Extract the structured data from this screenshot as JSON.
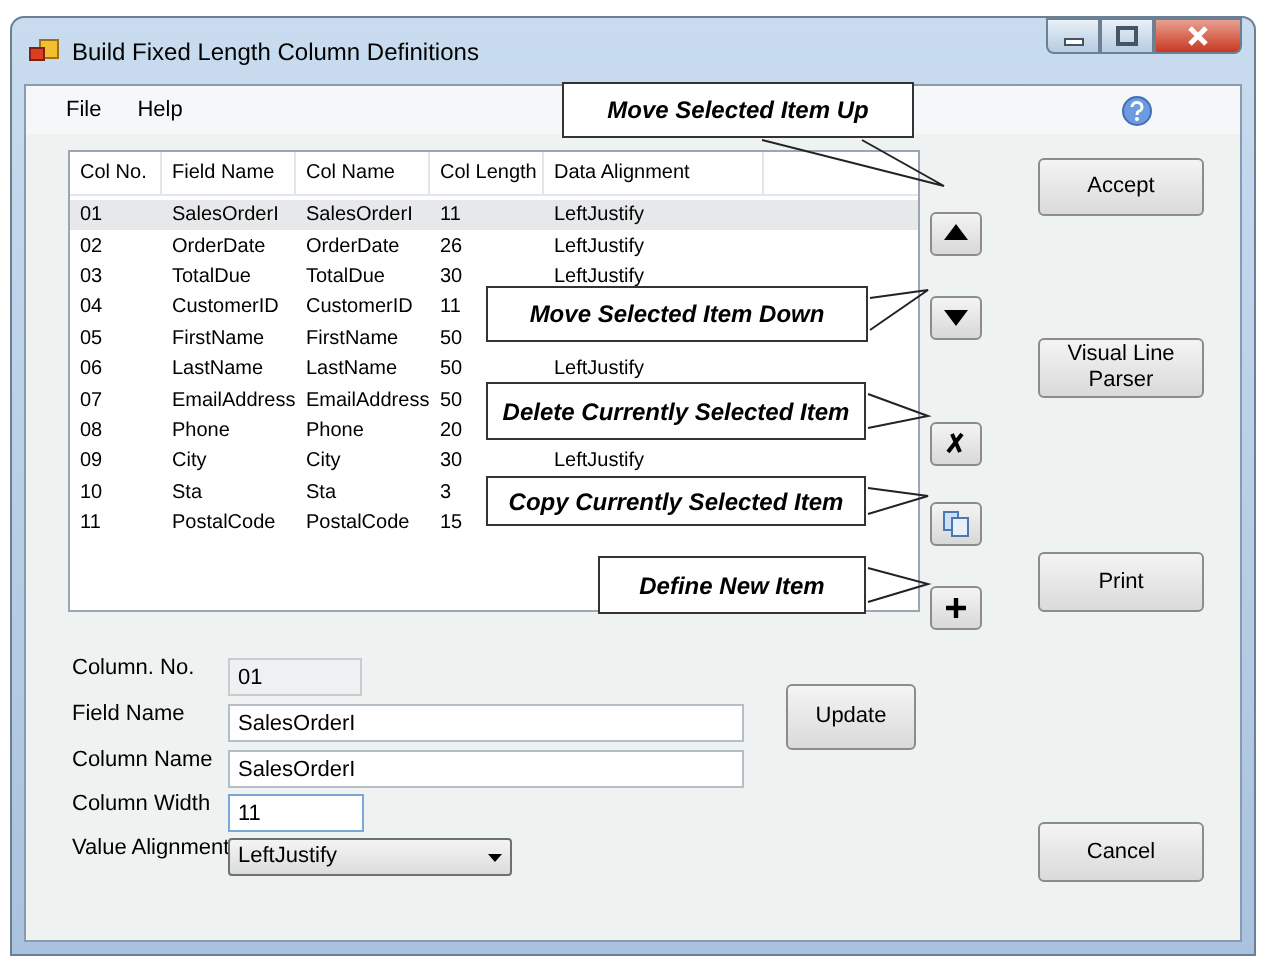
{
  "window": {
    "title": "Build Fixed Length Column Definitions"
  },
  "menu": [
    "File",
    "Help"
  ],
  "list": {
    "columns": [
      "Col No.",
      "Field Name",
      "Col Name",
      "Col Length",
      "Data Alignment"
    ],
    "rows": [
      {
        "cells": [
          "01",
          "SalesOrderI",
          "SalesOrderI",
          "11",
          "LeftJustify"
        ],
        "selected": true
      },
      {
        "cells": [
          "02",
          "OrderDate",
          "OrderDate",
          "26",
          "LeftJustify"
        ],
        "selected": false
      },
      {
        "cells": [
          "03",
          "TotalDue",
          "TotalDue",
          "30",
          "LeftJustify"
        ],
        "selected": false
      },
      {
        "cells": [
          "04",
          "CustomerID",
          "CustomerID",
          "11"
        ],
        "selected": false
      },
      {
        "cells": [
          "05",
          "FirstName",
          "FirstName",
          "50"
        ],
        "selected": false
      },
      {
        "cells": [
          "06",
          "LastName",
          "LastName",
          "50",
          "LeftJustify"
        ],
        "selected": false
      },
      {
        "cells": [
          "07",
          "EmailAddress",
          "EmailAddress",
          "50"
        ],
        "selected": false
      },
      {
        "cells": [
          "08",
          "Phone",
          "Phone",
          "20"
        ],
        "selected": false
      },
      {
        "cells": [
          "09",
          "City",
          "City",
          "30",
          "LeftJustify"
        ],
        "selected": false
      },
      {
        "cells": [
          "10",
          "Sta",
          "Sta",
          "3"
        ],
        "selected": false
      },
      {
        "cells": [
          "11",
          "PostalCode",
          "PostalCode",
          "15"
        ],
        "selected": false
      }
    ]
  },
  "tool_buttons": [
    {
      "kind": "up"
    },
    {
      "kind": "down"
    },
    {
      "kind": "delete"
    },
    {
      "kind": "copy"
    },
    {
      "kind": "add"
    }
  ],
  "callouts": [
    {
      "text": "Move Selected Item Up"
    },
    {
      "text": "Move Selected Item Down"
    },
    {
      "text": "Delete Currently Selected Item"
    },
    {
      "text": "Copy Currently Selected Item"
    },
    {
      "text": "Define New Item"
    }
  ],
  "form": [
    {
      "label": "Column. No.",
      "value": "01",
      "kind": "readonly",
      "focused": false
    },
    {
      "label": "Field Name",
      "value": "SalesOrderI",
      "kind": "text",
      "focused": false
    },
    {
      "label": "Column Name",
      "value": "SalesOrderI",
      "kind": "text",
      "focused": false
    },
    {
      "label": "Column Width",
      "value": "11",
      "kind": "short",
      "focused": true
    },
    {
      "label": "Value Alignment",
      "value": "LeftJustify",
      "kind": "select",
      "focused": false
    }
  ],
  "update_button": "Update",
  "side_buttons": [
    "Accept",
    "Visual Line\nParser",
    "Print",
    "Cancel"
  ]
}
